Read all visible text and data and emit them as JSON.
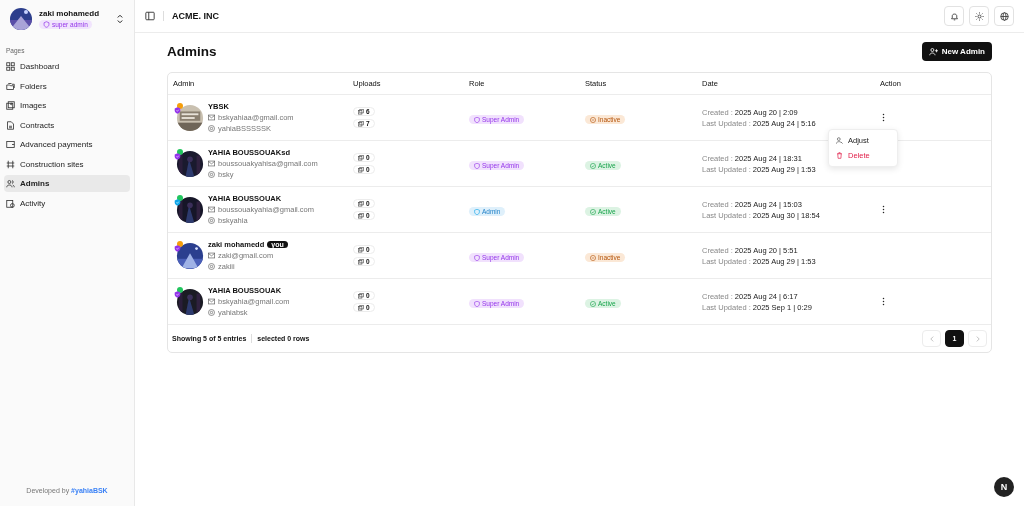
{
  "user": {
    "name": "zaki mohamedd",
    "role": "super admin"
  },
  "sidebar": {
    "section": "Pages",
    "items": [
      {
        "label": "Dashboard",
        "kind": "grid",
        "selected": false
      },
      {
        "label": "Folders",
        "kind": "folders",
        "selected": false
      },
      {
        "label": "Images",
        "kind": "images",
        "selected": false
      },
      {
        "label": "Contracts",
        "kind": "file",
        "selected": false
      },
      {
        "label": "Advanced payments",
        "kind": "wallet",
        "selected": false
      },
      {
        "label": "Construction sites",
        "kind": "sites",
        "selected": false
      },
      {
        "label": "Admins",
        "kind": "users",
        "selected": true
      },
      {
        "label": "Activity",
        "kind": "activity",
        "selected": false
      }
    ],
    "footer_label": "Developed by",
    "footer_link": "#yahiaBSK"
  },
  "header": {
    "title": "ACME. INC"
  },
  "page": {
    "title": "Admins",
    "new_button": "New Admin"
  },
  "table": {
    "columns": [
      "Admin",
      "Uploads",
      "Role",
      "Status",
      "Date",
      "Action"
    ],
    "rows": [
      {
        "name": "YBSK",
        "you": "",
        "email": "bskyahiaa@gmail.com",
        "username": "yahiaBSSSSSK",
        "uploads": [
          "6",
          "7"
        ],
        "role": {
          "label": "Super Admin",
          "kind": "super"
        },
        "status": {
          "label": "Inactive",
          "kind": "inactive"
        },
        "created_label": "Created :",
        "created": "2025 Aug 20 | 2:09",
        "updated_label": "Last Updated :",
        "updated": "2025 Aug 24 | 5:16",
        "action": true
      },
      {
        "name": "YAHIA BOUSSOUAKsd",
        "you": "",
        "email": "boussouakyahisa@gmail.com",
        "username": "bsky",
        "uploads": [
          "0",
          "0"
        ],
        "role": {
          "label": "Super Admin",
          "kind": "super"
        },
        "status": {
          "label": "Active",
          "kind": "active"
        },
        "created_label": "Created :",
        "created": "2025 Aug 24 | 18:31",
        "updated_label": "Last Updated :",
        "updated": "2025 Aug 29 | 1:53",
        "action": false
      },
      {
        "name": "YAHIA BOUSSOUAK",
        "you": "",
        "email": "boussouakyahia@gmail.com",
        "username": "bskyahia",
        "uploads": [
          "0",
          "0"
        ],
        "role": {
          "label": "Admin",
          "kind": "admin"
        },
        "status": {
          "label": "Active",
          "kind": "active"
        },
        "created_label": "Created :",
        "created": "2025 Aug 24 | 15:03",
        "updated_label": "Last Updated :",
        "updated": "2025 Aug 30 | 18:54",
        "action": true
      },
      {
        "name": "zaki mohamedd",
        "you": "you",
        "email": "zaki@gmail.com",
        "username": "zakiii",
        "uploads": [
          "0",
          "0"
        ],
        "role": {
          "label": "Super Admin",
          "kind": "super"
        },
        "status": {
          "label": "Inactive",
          "kind": "inactive"
        },
        "created_label": "Created :",
        "created": "2025 Aug 20 | 5:51",
        "updated_label": "Last Updated :",
        "updated": "2025 Aug 29 | 1:53",
        "action": false
      },
      {
        "name": "YAHIA BOUSSOUAK",
        "you": "",
        "email": "bskyahia@gmail.com",
        "username": "yahiabsk",
        "uploads": [
          "0",
          "0"
        ],
        "role": {
          "label": "Super Admin",
          "kind": "super"
        },
        "status": {
          "label": "Active",
          "kind": "active"
        },
        "created_label": "Created :",
        "created": "2025 Aug 24 | 6:17",
        "updated_label": "Last Updated :",
        "updated": "2025 Sep 1 | 0:29",
        "action": true
      }
    ],
    "footer": {
      "showing": "Showing 5 of 5 entries",
      "selected": "selected 0 rows"
    },
    "pages": [
      {
        "label": "1",
        "selected": true
      }
    ]
  },
  "menu": {
    "items": [
      {
        "label": "Adjust",
        "kind": "normal"
      },
      {
        "label": "Delete",
        "kind": "danger"
      }
    ]
  },
  "dev_badge": "N"
}
